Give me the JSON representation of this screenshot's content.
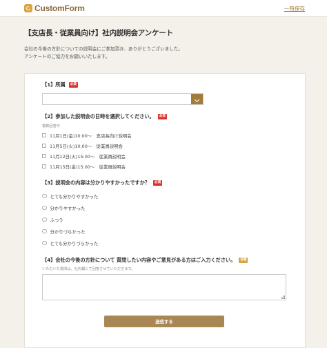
{
  "header": {
    "brand": "CustomForm",
    "temp_save": "一時保存"
  },
  "page": {
    "title": "【支店長・従業員向け】社内説明会アンケート",
    "intro_line1": "会社の今後の方針についての説明会にご参加頂き、ありがとうございました。",
    "intro_line2": "アンケートのご協力をお願いいたします。"
  },
  "badges": {
    "required": "必須",
    "optional": "任意"
  },
  "q1": {
    "label": "【1】所属",
    "selected": ""
  },
  "q2": {
    "label": "【2】参加した説明会の日時を選択してください。",
    "hint": "複数回答可",
    "options": [
      "11月1日(金)10:00～　支店長向け説明会",
      "11月5日(火)10:00～　従業員説明会",
      "11月12日(火)15:00～　従業員説明会",
      "11月15日(金)15:00～　従業員説明会"
    ]
  },
  "q3": {
    "label": "【3】説明会の内容は分かりやすかったですか？",
    "options": [
      "とても分かりやすかった",
      "分かりやすかった",
      "ふつう",
      "分かりづらかった",
      "とても分かりづらかった"
    ]
  },
  "q4": {
    "label": "【4】会社の今後の方針について 質問したい内容やご意見がある方はご入力ください。",
    "hint": "いただいた質問は、社内報にて回答させていただきます。",
    "value": ""
  },
  "submit_label": "送信する",
  "colors": {
    "accent": "#a07d3b",
    "required_badge": "#d9342b",
    "optional_badge": "#d9a441",
    "background": "#f4f1ea"
  }
}
